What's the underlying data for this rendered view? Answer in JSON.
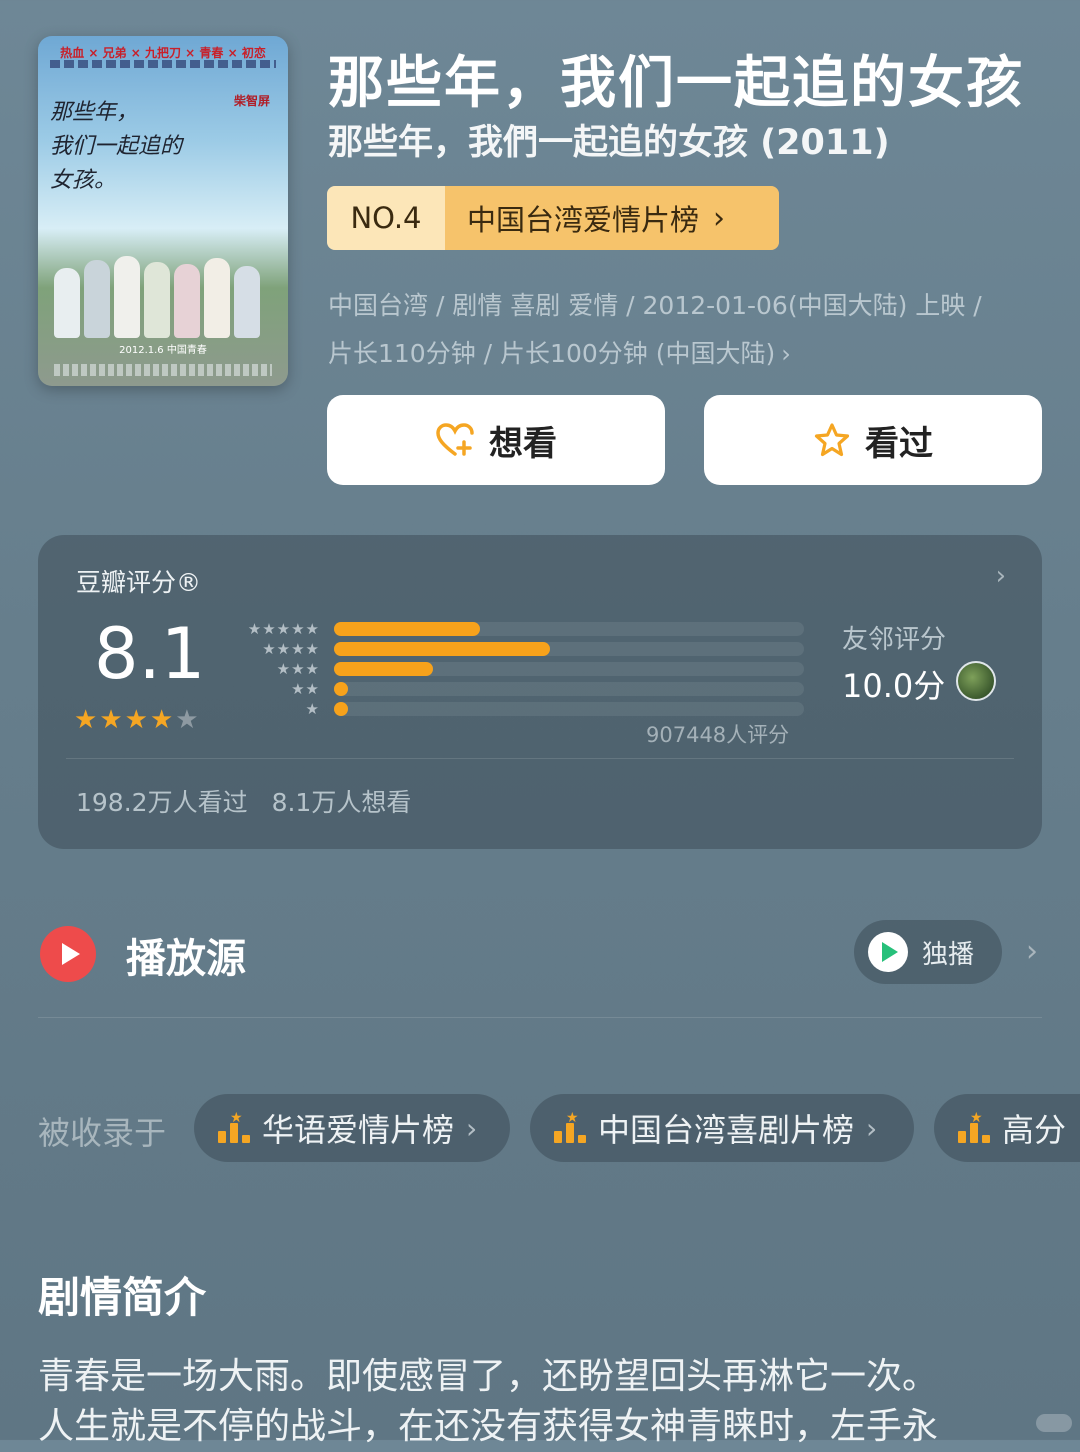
{
  "poster": {
    "tagline": "热血 × 兄弟 × 九把刀 × 青春 × 初恋",
    "handwritten_lines": [
      "那些年，",
      "我们一起追的",
      "女孩。"
    ],
    "director": "柴智屏",
    "release_note": "2012.1.6 中国青春"
  },
  "movie": {
    "title": "那些年，我们一起追的女孩",
    "original_title": "那些年，我們一起追的女孩 (2011)",
    "rank_number": "NO.4",
    "rank_list": "中国台湾爱情片榜",
    "meta_line1": "中国台湾 / 剧情 喜剧 爱情 / 2012-01-06(中国大陆) 上映 /",
    "meta_line2": "片长110分钟 / 片长100分钟 (中国大陆)"
  },
  "actions": {
    "want_label": "想看",
    "seen_label": "看过"
  },
  "rating": {
    "label": "豆瓣评分®",
    "score": "8.1",
    "stars_filled": 4,
    "stars_total": 5,
    "distribution": [
      {
        "stars": "★★★★★",
        "fraction": 0.31
      },
      {
        "stars": "★★★★",
        "fraction": 0.46
      },
      {
        "stars": "★★★",
        "fraction": 0.21
      },
      {
        "stars": "★★",
        "fraction": 0.03
      },
      {
        "stars": "★",
        "fraction": 0.03
      }
    ],
    "count_text": "907448人评分",
    "friend_label": "友邻评分",
    "friend_score": "10.0分",
    "watched_text": "198.2万人看过",
    "wish_text": "8.1万人想看",
    "accent": "#f7a21b"
  },
  "play": {
    "title": "播放源",
    "badge": "独播"
  },
  "collections": {
    "label": "被收录于",
    "items": [
      "华语爱情片榜",
      "中国台湾喜剧片榜",
      "高分"
    ]
  },
  "synopsis": {
    "title": "剧情简介",
    "line1": "青春是一场大雨。即使感冒了，还盼望回头再淋它一次。",
    "line2": "人生就是不停的战斗，在还没有获得女神青睐时，左手永"
  }
}
